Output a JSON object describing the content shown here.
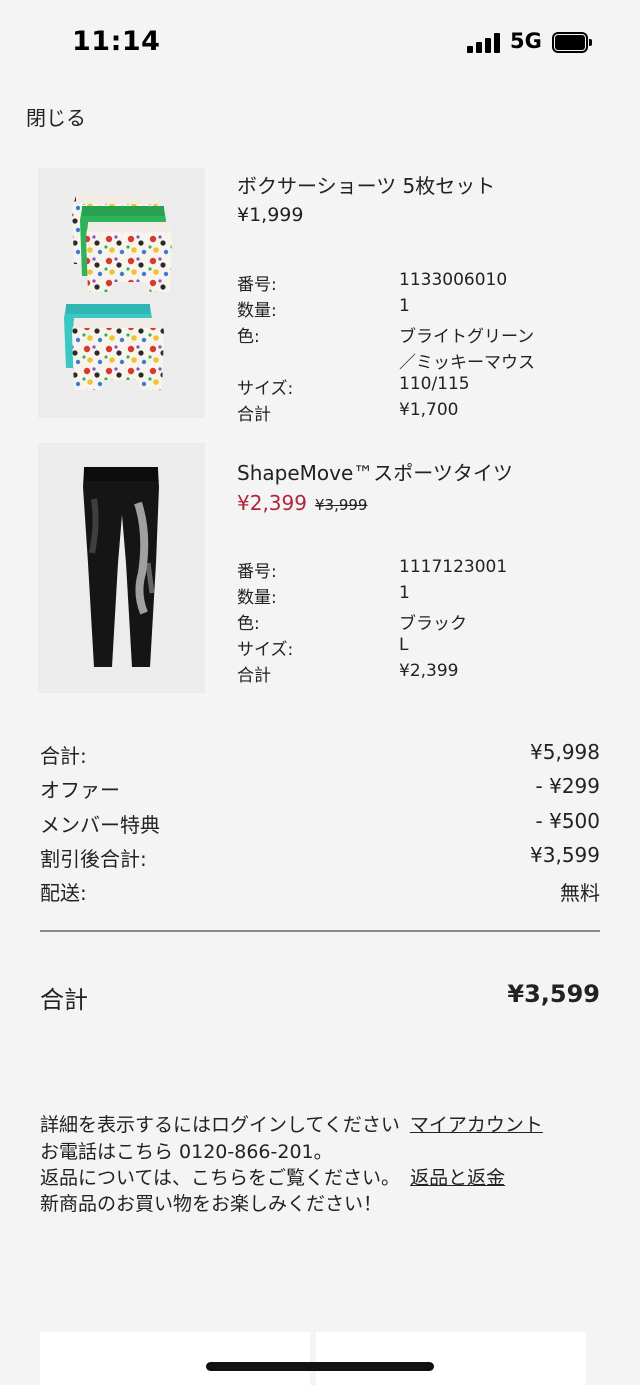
{
  "status_bar": {
    "time": "11:14",
    "network": "5G"
  },
  "header": {
    "close_label": "閉じる"
  },
  "items": [
    {
      "name": "ボクサーショーツ 5枚セット",
      "price": "¥1,999",
      "specs": [
        {
          "label": "番号:",
          "value": "1133006010"
        },
        {
          "label": "数量:",
          "value": "1"
        },
        {
          "label": "色:",
          "value": "ブライトグリーン"
        },
        {
          "label": "",
          "value": "／ミッキーマウス"
        },
        {
          "label": "サイズ:",
          "value": "110/115"
        },
        {
          "label": "合計",
          "value": "¥1,700"
        }
      ]
    },
    {
      "name": "ShapeMove™スポーツタイツ",
      "sale_price": "¥2,399",
      "original_price": "¥3,999",
      "specs": [
        {
          "label": "番号:",
          "value": "1117123001"
        },
        {
          "label": "数量:",
          "value": "1"
        },
        {
          "label": "色:",
          "value": "ブラック"
        },
        {
          "label": "サイズ:",
          "value": "L"
        },
        {
          "label": "合計",
          "value": "¥2,399"
        }
      ]
    }
  ],
  "summary": {
    "rows": [
      {
        "label": "合計:",
        "value": "¥5,998"
      },
      {
        "label": "オファー",
        "value": "- ¥299"
      },
      {
        "label": "メンバー特典",
        "value": "- ¥500"
      },
      {
        "label": "割引後合計:",
        "value": "¥3,599"
      },
      {
        "label": "配送:",
        "value": "無料"
      }
    ],
    "total_label": "合計",
    "total_value": "¥3,599"
  },
  "info": {
    "login_text": "詳細を表示するにはログインしてください",
    "login_link": "マイアカウント",
    "phone_text": "お電話はこちら 0120-866-201。",
    "returns_text": "返品については、こちらをご覧ください。",
    "returns_link": "返品と返金",
    "enjoy_text": "新商品のお買い物をお楽しみください！"
  },
  "colors": {
    "sale": "#b1253a",
    "background": "#f4f4f4",
    "shorts_green": "#2fb35a",
    "shorts_aqua": "#39c8c4"
  }
}
